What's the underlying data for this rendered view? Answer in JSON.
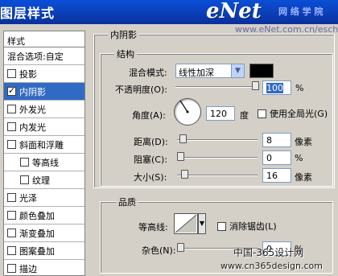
{
  "window": {
    "title": "图层样式"
  },
  "watermark": {
    "logo": "eNet",
    "logo_suffix": "网 络 学 院",
    "url": "www.eNet.com.cn/eschool",
    "site_line1": "中国-365设计网",
    "site_line2": "www.cn365design.com"
  },
  "sidebar": {
    "header": "样式",
    "items": [
      {
        "label": "混合选项:自定",
        "checkbox": false,
        "checked": false,
        "indent": false
      },
      {
        "label": "投影",
        "checkbox": true,
        "checked": false,
        "indent": false
      },
      {
        "label": "内阴影",
        "checkbox": true,
        "checked": true,
        "indent": false,
        "selected": true
      },
      {
        "label": "外发光",
        "checkbox": true,
        "checked": false,
        "indent": false
      },
      {
        "label": "内发光",
        "checkbox": true,
        "checked": false,
        "indent": false
      },
      {
        "label": "斜面和浮雕",
        "checkbox": true,
        "checked": false,
        "indent": false
      },
      {
        "label": "等高线",
        "checkbox": true,
        "checked": false,
        "indent": true
      },
      {
        "label": "纹理",
        "checkbox": true,
        "checked": false,
        "indent": true
      },
      {
        "label": "光泽",
        "checkbox": true,
        "checked": false,
        "indent": false
      },
      {
        "label": "颜色叠加",
        "checkbox": true,
        "checked": false,
        "indent": false
      },
      {
        "label": "渐变叠加",
        "checkbox": true,
        "checked": false,
        "indent": false
      },
      {
        "label": "图案叠加",
        "checkbox": true,
        "checked": false,
        "indent": false
      },
      {
        "label": "描边",
        "checkbox": true,
        "checked": false,
        "indent": false
      }
    ]
  },
  "inner_shadow": {
    "group_title": "内阴影",
    "structure": {
      "title": "结构",
      "blend_mode_label": "混合模式:",
      "blend_mode_value": "线性加深",
      "shadow_color": "#000000",
      "opacity_label": "不透明度(O):",
      "opacity_value": "100",
      "opacity_unit": "%",
      "angle_label": "角度(A):",
      "angle_value": "120",
      "angle_unit": "度",
      "global_light_label": "使用全局光(G)",
      "distance_label": "距离(D):",
      "distance_value": "8",
      "distance_unit": "像素",
      "choke_label": "阻塞(C):",
      "choke_value": "0",
      "choke_unit": "%",
      "size_label": "大小(S):",
      "size_value": "16",
      "size_unit": "像素"
    },
    "quality": {
      "title": "品质",
      "contour_label": "等高线:",
      "antialias_label": "消除锯齿(L)",
      "noise_label": "杂色(N):",
      "noise_value": "0",
      "noise_unit": "%"
    }
  },
  "levels": {
    "opacity": 1.0,
    "distance": 0.03,
    "choke": 0.0,
    "size": 0.06,
    "noise": 0.0
  }
}
